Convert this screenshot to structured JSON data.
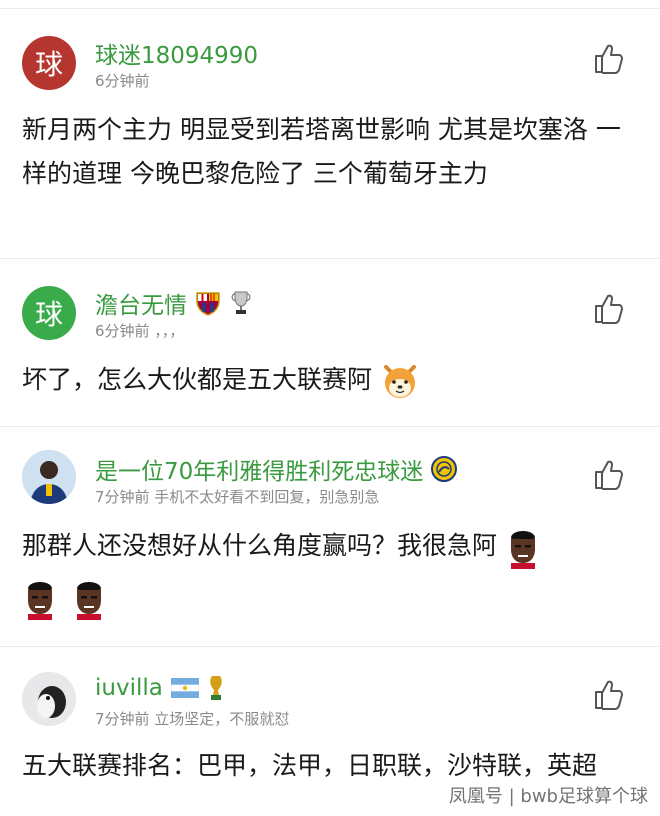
{
  "comments": [
    {
      "username": "球迷18094990",
      "avatar_text": "球",
      "avatar_color": "#b5362f",
      "meta": "6分钟前",
      "text": "新月两个主力 明显受到若塔离世影响 尤其是坎塞洛 一样的道理 今晚巴黎危险了 三个葡萄牙主力",
      "badges": []
    },
    {
      "username": "澹台无情",
      "avatar_text": "球",
      "avatar_color": "#3aab4a",
      "meta": "6分钟前 ，，，",
      "text": "坏了，怎么大伙都是五大联赛阿",
      "badges": [
        "fc-barcelona-badge-icon",
        "trophy-icon"
      ],
      "emoji": "shiba-dog-emoji-icon"
    },
    {
      "username": "是一位70年利雅得胜利死忠球迷",
      "avatar_text": "",
      "meta": "7分钟前 手机不太好看不到回复，别急别急",
      "text": "那群人还没想好从什么角度赢吗？我很急阿",
      "badges": [
        "al-nassr-badge-icon"
      ],
      "emoji": "player-sticker-icon"
    },
    {
      "username": "iuvilla",
      "avatar_text": "",
      "meta": "7分钟前 立场坚定，不服就怼",
      "text": "五大联赛排名：巴甲，法甲，日职联，沙特联，英超",
      "badges": [
        "argentina-flag-icon",
        "world-cup-trophy-icon"
      ]
    }
  ],
  "watermark": "凤凰号 | bwb足球算个球",
  "icons": {
    "like": "thumbs-up-icon"
  }
}
